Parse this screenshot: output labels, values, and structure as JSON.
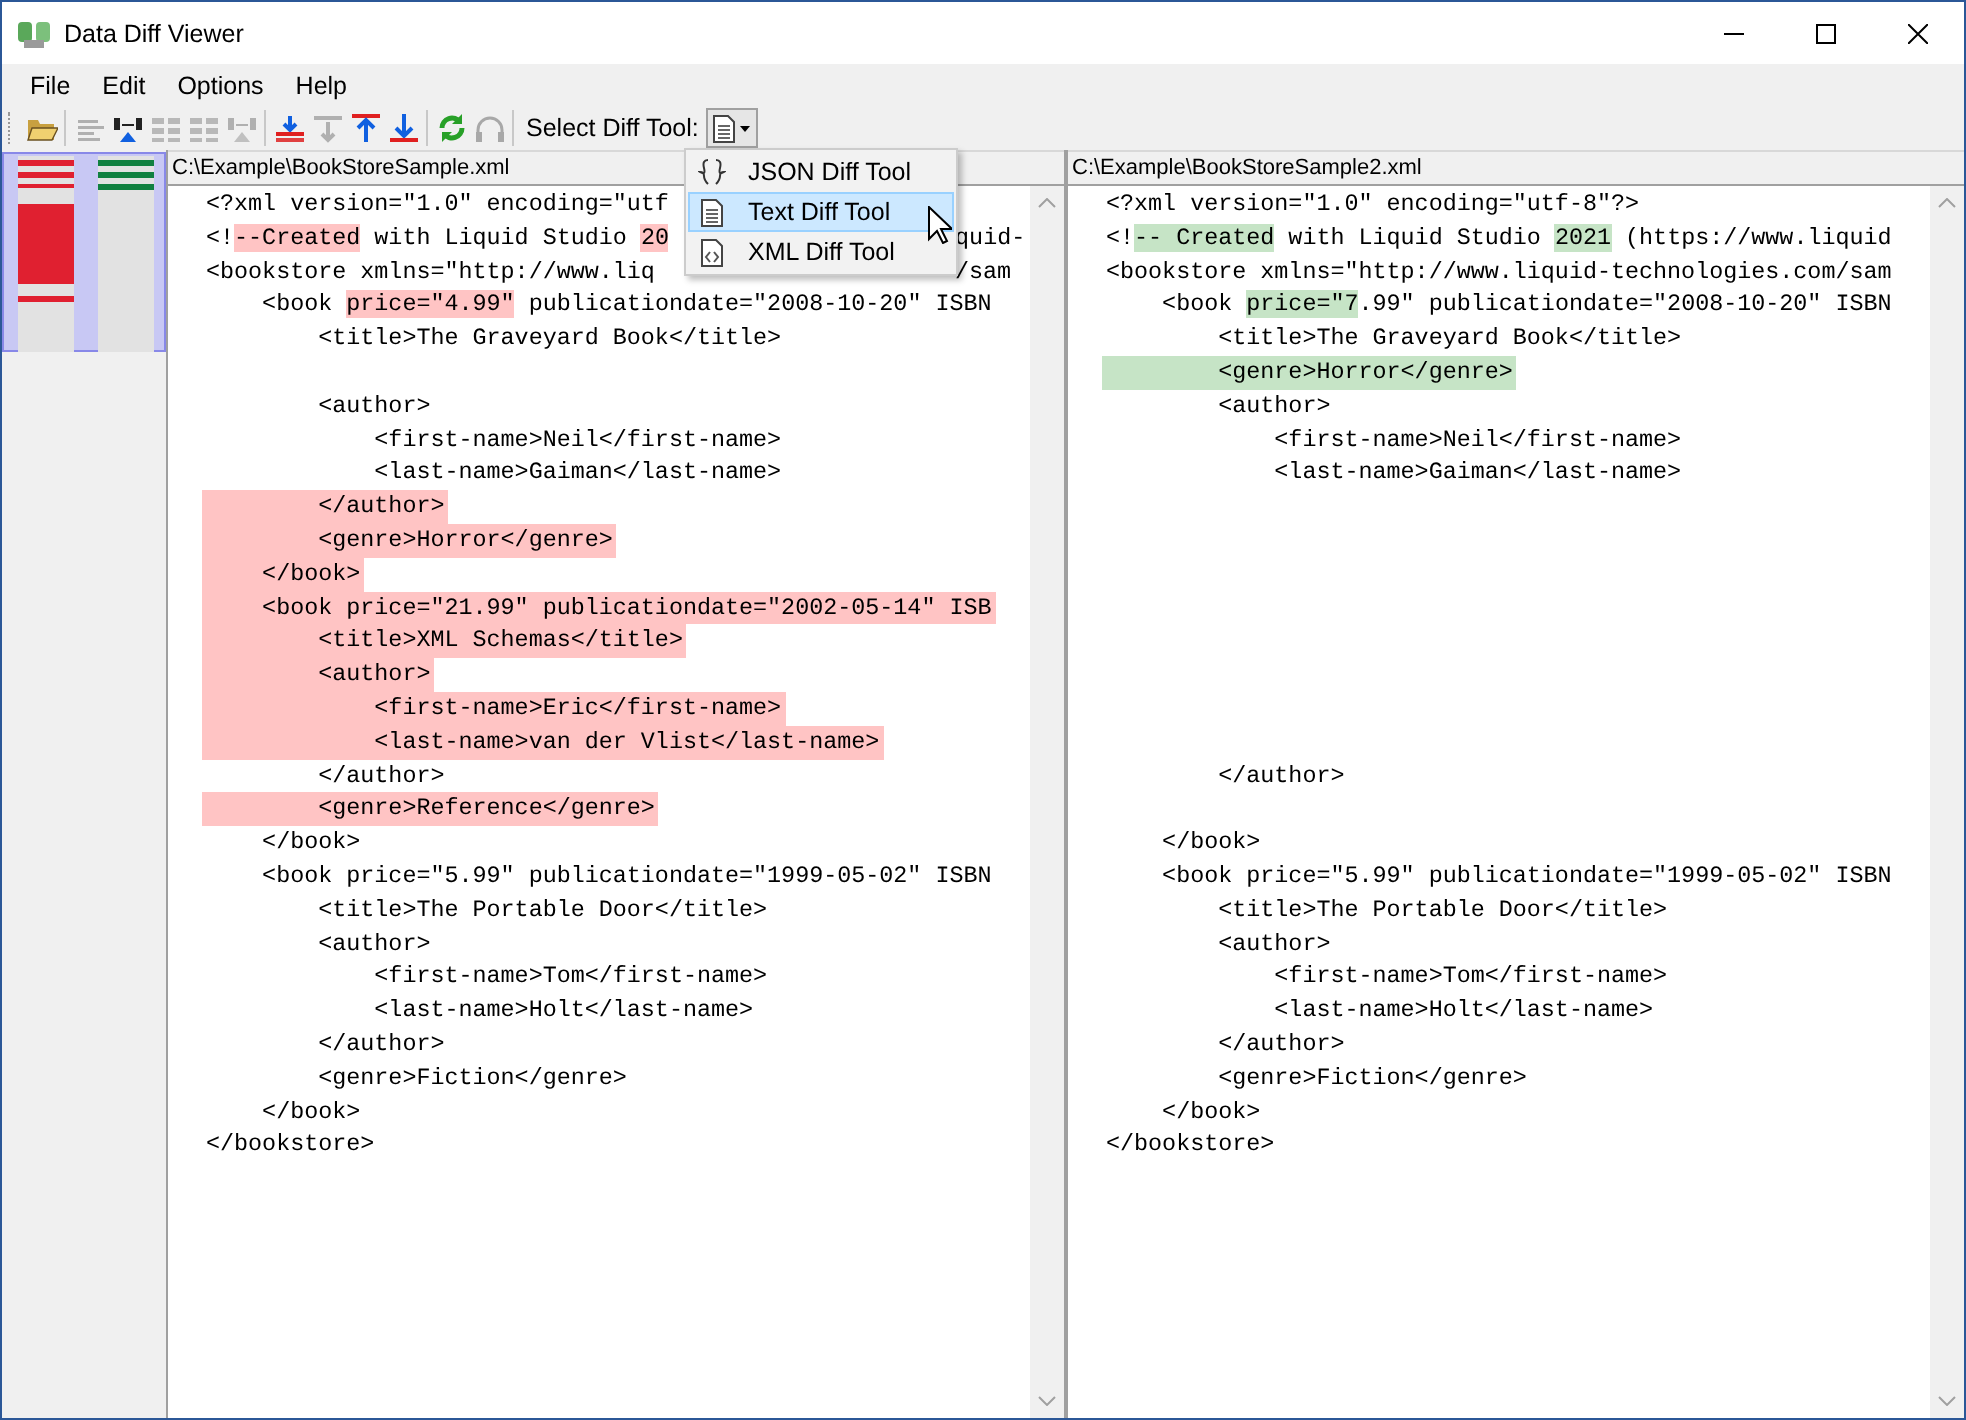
{
  "window": {
    "title": "Data Diff Viewer"
  },
  "menu": [
    "File",
    "Edit",
    "Options",
    "Help"
  ],
  "toolbar": {
    "buttons": [
      {
        "disabled": false
      },
      {
        "disabled": true
      },
      {
        "disabled": false
      },
      {
        "disabled": true
      },
      {
        "disabled": true
      },
      {
        "disabled": true
      },
      {
        "disabled": false
      },
      {
        "disabled": true
      },
      {
        "disabled": false
      },
      {
        "disabled": false
      },
      {
        "disabled": false
      },
      {
        "disabled": true
      }
    ],
    "tool_label": "Select Diff Tool:",
    "tool_menu_open": true,
    "tool_menu": [
      {
        "label": "JSON Diff Tool",
        "selected": false
      },
      {
        "label": "Text Diff Tool",
        "selected": true
      },
      {
        "label": "XML Diff Tool",
        "selected": false
      }
    ]
  },
  "panes": [
    {
      "path": "C:\\Example\\BookStoreSample.xml",
      "kind": "removed",
      "lines": [
        {
          "kind": "code",
          "changed": false,
          "text": "<?xml version=\"1.0\" encoding=\"utf"
        },
        {
          "kind": "code",
          "changed": false,
          "parts": [
            {
              "text": "<!",
              "changed": false
            },
            {
              "text": "--Created",
              "changed": true
            },
            {
              "text": " with Liquid Studio ",
              "changed": false
            },
            {
              "text": "20",
              "changed": true
            },
            {
              "text": "quid-",
              "changed": false,
              "after_menu": true
            }
          ]
        },
        {
          "kind": "code",
          "changed": false,
          "parts": [
            {
              "text": "<bookstore xmlns=\"http://www.liq",
              "changed": false
            },
            {
              "text": "/sam",
              "changed": false,
              "after_menu": true
            }
          ]
        },
        {
          "kind": "code",
          "changed": false,
          "parts": [
            {
              "text": "    <book ",
              "changed": false
            },
            {
              "text": "price=\"4.99\"",
              "changed": true
            },
            {
              "text": " publicationdate=\"2008-10-20\" ISBN",
              "changed": false
            }
          ]
        },
        {
          "kind": "code",
          "changed": false,
          "text": "        <title>The Graveyard Book</title>"
        },
        {
          "kind": "blank",
          "changed": false
        },
        {
          "kind": "code",
          "changed": false,
          "text": "        <author>"
        },
        {
          "kind": "code",
          "changed": false,
          "text": "            <first-name>Neil</first-name>"
        },
        {
          "kind": "code",
          "changed": false,
          "text": "            <last-name>Gaiman</last-name>"
        },
        {
          "kind": "code",
          "changed": true,
          "text": "        </author>"
        },
        {
          "kind": "code",
          "changed": true,
          "text": "        <genre>Horror</genre>"
        },
        {
          "kind": "code",
          "changed": true,
          "text": "    </book>"
        },
        {
          "kind": "code",
          "changed": true,
          "text": "    <book price=\"21.99\" publicationdate=\"2002-05-14\" ISB"
        },
        {
          "kind": "code",
          "changed": true,
          "text": "        <title>XML Schemas</title>"
        },
        {
          "kind": "code",
          "changed": true,
          "text": "        <author>"
        },
        {
          "kind": "code",
          "changed": true,
          "text": "            <first-name>Eric</first-name>"
        },
        {
          "kind": "code",
          "changed": true,
          "text": "            <last-name>van der Vlist</last-name>"
        },
        {
          "kind": "code",
          "changed": false,
          "text": "        </author>"
        },
        {
          "kind": "code",
          "changed": true,
          "text": "        <genre>Reference</genre>"
        },
        {
          "kind": "code",
          "changed": false,
          "text": "    </book>"
        },
        {
          "kind": "code",
          "changed": false,
          "text": "    <book price=\"5.99\" publicationdate=\"1999-05-02\" ISBN"
        },
        {
          "kind": "code",
          "changed": false,
          "text": "        <title>The Portable Door</title>"
        },
        {
          "kind": "code",
          "changed": false,
          "text": "        <author>"
        },
        {
          "kind": "code",
          "changed": false,
          "text": "            <first-name>Tom</first-name>"
        },
        {
          "kind": "code",
          "changed": false,
          "text": "            <last-name>Holt</last-name>"
        },
        {
          "kind": "code",
          "changed": false,
          "text": "        </author>"
        },
        {
          "kind": "code",
          "changed": false,
          "text": "        <genre>Fiction</genre>"
        },
        {
          "kind": "code",
          "changed": false,
          "text": "    </book>"
        },
        {
          "kind": "code",
          "changed": false,
          "text": "</bookstore>"
        }
      ]
    },
    {
      "path": "C:\\Example\\BookStoreSample2.xml",
      "kind": "added",
      "lines": [
        {
          "kind": "code",
          "changed": false,
          "text": "<?xml version=\"1.0\" encoding=\"utf-8\"?>"
        },
        {
          "kind": "code",
          "changed": false,
          "parts": [
            {
              "text": "<!",
              "changed": false
            },
            {
              "text": "-- Created",
              "changed": true
            },
            {
              "text": " with Liquid Studio ",
              "changed": false
            },
            {
              "text": "2021",
              "changed": true
            },
            {
              "text": " (https://www.liquid",
              "changed": false
            }
          ]
        },
        {
          "kind": "code",
          "changed": false,
          "text": "<bookstore xmlns=\"http://www.liquid-technologies.com/sam"
        },
        {
          "kind": "code",
          "changed": false,
          "parts": [
            {
              "text": "    <book ",
              "changed": false
            },
            {
              "text": "price=\"7",
              "changed": true
            },
            {
              "text": ".99\" publicationdate=\"2008-10-20\" ISBN",
              "changed": false
            }
          ]
        },
        {
          "kind": "code",
          "changed": false,
          "text": "        <title>The Graveyard Book</title>"
        },
        {
          "kind": "code",
          "changed": true,
          "text": "        <genre>Horror</genre>"
        },
        {
          "kind": "code",
          "changed": false,
          "text": "        <author>"
        },
        {
          "kind": "code",
          "changed": false,
          "text": "            <first-name>Neil</first-name>"
        },
        {
          "kind": "code",
          "changed": false,
          "text": "            <last-name>Gaiman</last-name>"
        },
        {
          "kind": "blank",
          "changed": false
        },
        {
          "kind": "blank",
          "changed": false
        },
        {
          "kind": "blank",
          "changed": false
        },
        {
          "kind": "blank",
          "changed": false
        },
        {
          "kind": "blank",
          "changed": false
        },
        {
          "kind": "blank",
          "changed": false
        },
        {
          "kind": "blank",
          "changed": false
        },
        {
          "kind": "blank",
          "changed": false
        },
        {
          "kind": "code",
          "changed": false,
          "text": "        </author>"
        },
        {
          "kind": "blank",
          "changed": false
        },
        {
          "kind": "code",
          "changed": false,
          "text": "    </book>"
        },
        {
          "kind": "code",
          "changed": false,
          "text": "    <book price=\"5.99\" publicationdate=\"1999-05-02\" ISBN"
        },
        {
          "kind": "code",
          "changed": false,
          "text": "        <title>The Portable Door</title>"
        },
        {
          "kind": "code",
          "changed": false,
          "text": "        <author>"
        },
        {
          "kind": "code",
          "changed": false,
          "text": "            <first-name>Tom</first-name>"
        },
        {
          "kind": "code",
          "changed": false,
          "text": "            <last-name>Holt</last-name>"
        },
        {
          "kind": "code",
          "changed": false,
          "text": "        </author>"
        },
        {
          "kind": "code",
          "changed": false,
          "text": "        <genre>Fiction</genre>"
        },
        {
          "kind": "code",
          "changed": false,
          "text": "    </book>"
        },
        {
          "kind": "code",
          "changed": false,
          "text": "</bookstore>"
        }
      ]
    }
  ]
}
